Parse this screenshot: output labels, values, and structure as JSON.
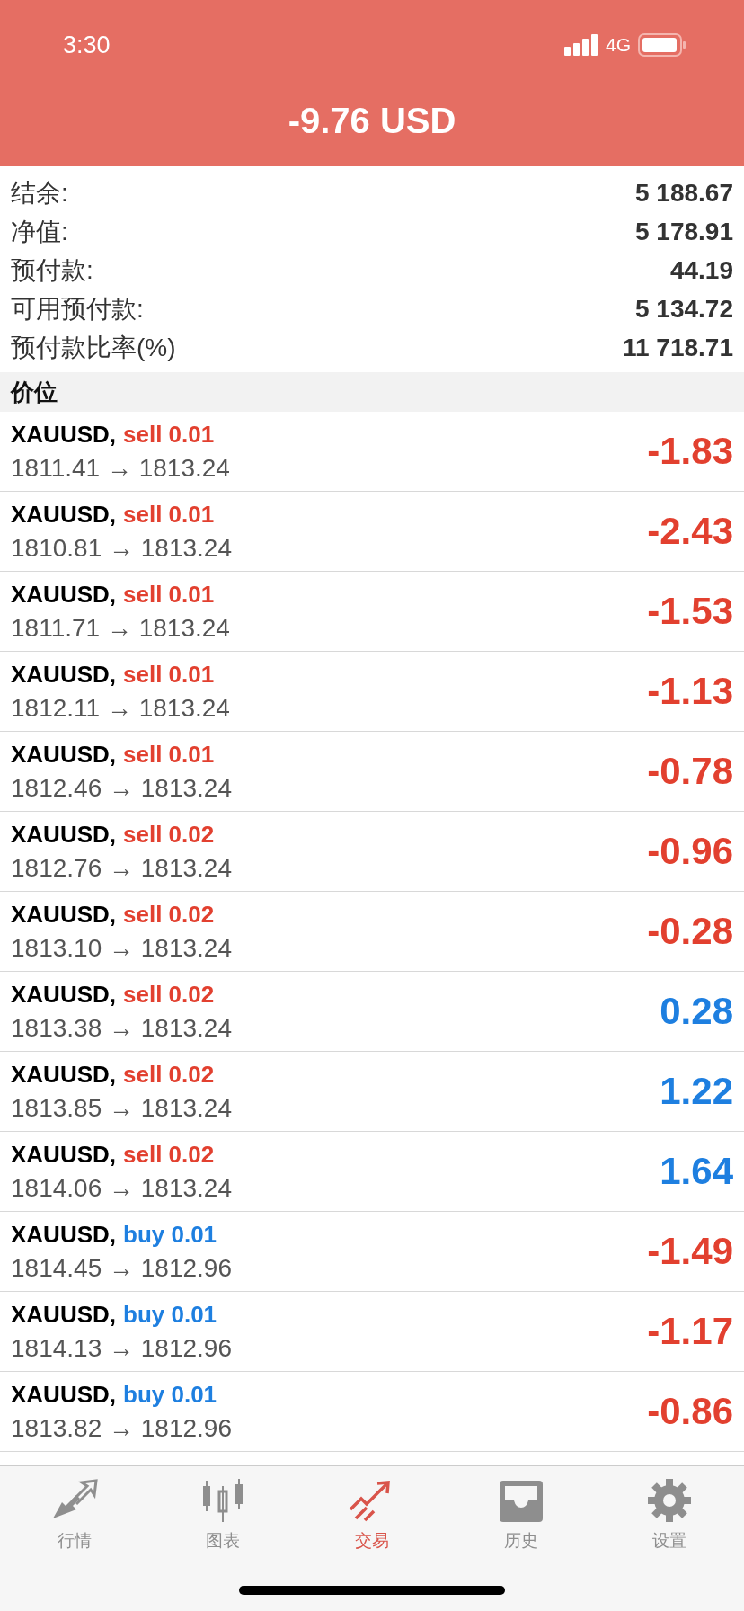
{
  "status_bar": {
    "time": "3:30",
    "network": "4G"
  },
  "header": {
    "title": "-9.76 USD"
  },
  "summary": [
    {
      "label": "结余:",
      "value": "5 188.67"
    },
    {
      "label": "净值:",
      "value": "5 178.91"
    },
    {
      "label": "预付款:",
      "value": "44.19"
    },
    {
      "label": "可用预付款:",
      "value": "5 134.72"
    },
    {
      "label": "预付款比率(%)",
      "value": "11 718.71"
    }
  ],
  "section": {
    "title": "价位"
  },
  "positions": [
    {
      "symbol": "XAUUSD,",
      "order": {
        "text": "sell 0.01",
        "color": "#e2402f"
      },
      "prices": "1811.41 → 1813.24",
      "profit": {
        "text": "-1.83",
        "color": "#e2402f"
      }
    },
    {
      "symbol": "XAUUSD,",
      "order": {
        "text": "sell 0.01",
        "color": "#e2402f"
      },
      "prices": "1810.81 → 1813.24",
      "profit": {
        "text": "-2.43",
        "color": "#e2402f"
      }
    },
    {
      "symbol": "XAUUSD,",
      "order": {
        "text": "sell 0.01",
        "color": "#e2402f"
      },
      "prices": "1811.71 → 1813.24",
      "profit": {
        "text": "-1.53",
        "color": "#e2402f"
      }
    },
    {
      "symbol": "XAUUSD,",
      "order": {
        "text": "sell 0.01",
        "color": "#e2402f"
      },
      "prices": "1812.11 → 1813.24",
      "profit": {
        "text": "-1.13",
        "color": "#e2402f"
      }
    },
    {
      "symbol": "XAUUSD,",
      "order": {
        "text": "sell 0.01",
        "color": "#e2402f"
      },
      "prices": "1812.46 → 1813.24",
      "profit": {
        "text": "-0.78",
        "color": "#e2402f"
      }
    },
    {
      "symbol": "XAUUSD,",
      "order": {
        "text": "sell 0.02",
        "color": "#e2402f"
      },
      "prices": "1812.76 → 1813.24",
      "profit": {
        "text": "-0.96",
        "color": "#e2402f"
      }
    },
    {
      "symbol": "XAUUSD,",
      "order": {
        "text": "sell 0.02",
        "color": "#e2402f"
      },
      "prices": "1813.10 → 1813.24",
      "profit": {
        "text": "-0.28",
        "color": "#e2402f"
      }
    },
    {
      "symbol": "XAUUSD,",
      "order": {
        "text": "sell 0.02",
        "color": "#e2402f"
      },
      "prices": "1813.38 → 1813.24",
      "profit": {
        "text": "0.28",
        "color": "#1e7fe0"
      }
    },
    {
      "symbol": "XAUUSD,",
      "order": {
        "text": "sell 0.02",
        "color": "#e2402f"
      },
      "prices": "1813.85 → 1813.24",
      "profit": {
        "text": "1.22",
        "color": "#1e7fe0"
      }
    },
    {
      "symbol": "XAUUSD,",
      "order": {
        "text": "sell 0.02",
        "color": "#e2402f"
      },
      "prices": "1814.06 → 1813.24",
      "profit": {
        "text": "1.64",
        "color": "#1e7fe0"
      }
    },
    {
      "symbol": "XAUUSD,",
      "order": {
        "text": "buy 0.01",
        "color": "#1e7fe0"
      },
      "prices": "1814.45 → 1812.96",
      "profit": {
        "text": "-1.49",
        "color": "#e2402f"
      }
    },
    {
      "symbol": "XAUUSD,",
      "order": {
        "text": "buy 0.01",
        "color": "#1e7fe0"
      },
      "prices": "1814.13 → 1812.96",
      "profit": {
        "text": "-1.17",
        "color": "#e2402f"
      }
    },
    {
      "symbol": "XAUUSD,",
      "order": {
        "text": "buy 0.01",
        "color": "#1e7fe0"
      },
      "prices": "1813.82 → 1812.96",
      "profit": {
        "text": "-0.86",
        "color": "#e2402f"
      }
    }
  ],
  "tab_bar": [
    {
      "kind": "quotes",
      "label": "行情",
      "selected": false
    },
    {
      "kind": "chart",
      "label": "图表",
      "selected": false
    },
    {
      "kind": "trade",
      "label": "交易",
      "selected": true
    },
    {
      "kind": "history",
      "label": "历史",
      "selected": false
    },
    {
      "kind": "settings",
      "label": "设置",
      "selected": false
    }
  ]
}
